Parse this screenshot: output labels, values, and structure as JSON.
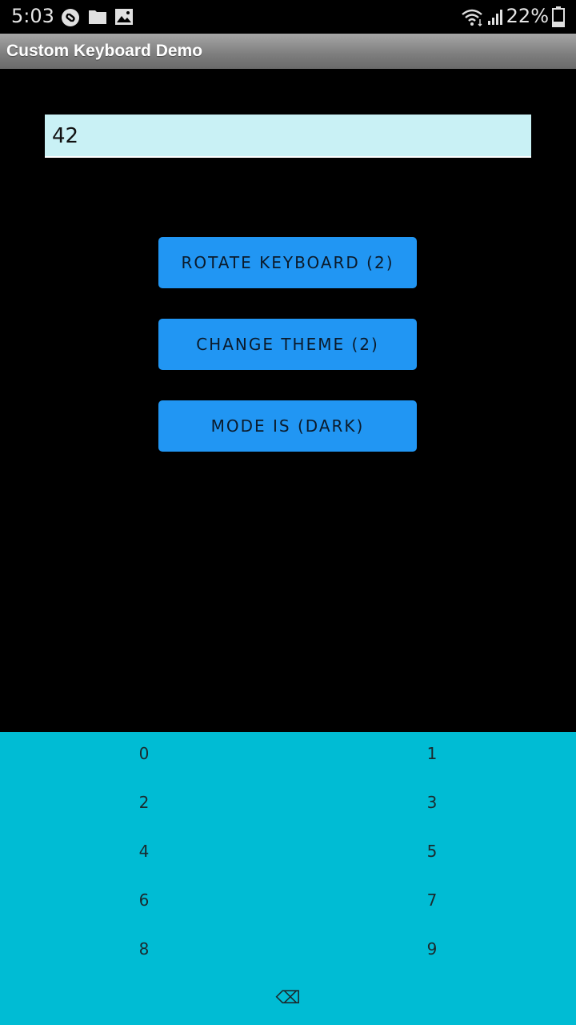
{
  "status_bar": {
    "time": "5:03",
    "battery_percent": "22%",
    "icons": [
      "shazam-icon",
      "folder-icon",
      "image-icon",
      "wifi-icon",
      "signal-icon",
      "battery-icon"
    ]
  },
  "action_bar": {
    "title": "Custom Keyboard Demo"
  },
  "entry": {
    "value": "42",
    "background_color": "#c9f1f5"
  },
  "buttons": {
    "rotate_keyboard": "ROTATE KEYBOARD (2)",
    "change_theme": "CHANGE THEME (2)",
    "mode": "MODE IS (DARK)",
    "color": "#2196f3"
  },
  "keyboard": {
    "background_color": "#00bcd4",
    "keys": [
      "0",
      "1",
      "2",
      "3",
      "4",
      "5",
      "6",
      "7",
      "8",
      "9"
    ],
    "backspace_glyph": "⌫"
  }
}
